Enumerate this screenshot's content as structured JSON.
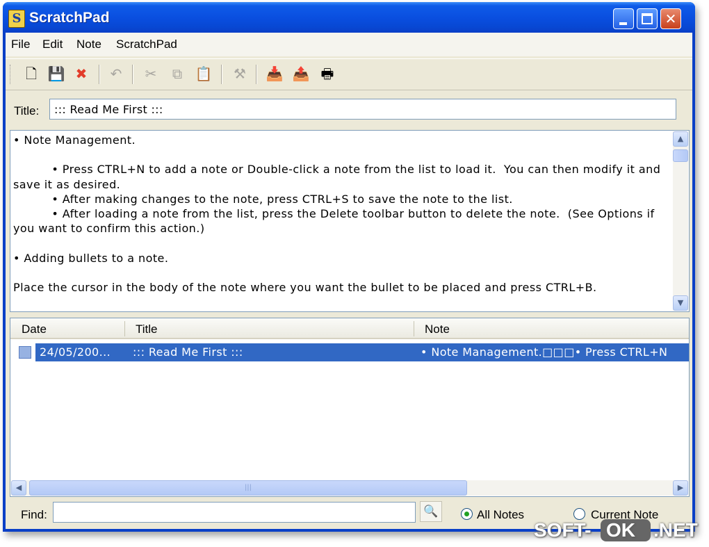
{
  "window": {
    "title": "ScratchPad",
    "icon_letter": "S",
    "minimize_icon": "minimize-icon",
    "maximize_icon": "maximize-icon",
    "close_icon": "close-icon",
    "close_glyph": "✕"
  },
  "menu": {
    "items": [
      {
        "label": "File"
      },
      {
        "label": "Edit"
      },
      {
        "label": "Note"
      },
      {
        "label": "ScratchPad"
      }
    ]
  },
  "toolbar": {
    "buttons": [
      {
        "icon": "new-note-icon",
        "glyph": "🗋",
        "enabled": true
      },
      {
        "icon": "save-icon",
        "glyph": "💾",
        "enabled": false
      },
      {
        "icon": "delete-icon",
        "glyph": "✖",
        "enabled": true,
        "color": "#e23c2a"
      },
      {
        "icon": "undo-icon",
        "glyph": "↶",
        "enabled": false
      },
      {
        "icon": "cut-icon",
        "glyph": "✂",
        "enabled": false
      },
      {
        "icon": "copy-icon",
        "glyph": "⧉",
        "enabled": false
      },
      {
        "icon": "paste-icon",
        "glyph": "📋",
        "enabled": false
      },
      {
        "icon": "options-icon",
        "glyph": "⚒",
        "enabled": false
      },
      {
        "icon": "import-icon",
        "glyph": "📥",
        "enabled": true
      },
      {
        "icon": "export-icon",
        "glyph": "📤",
        "enabled": true
      },
      {
        "icon": "print-icon",
        "glyph": "🖶",
        "enabled": true
      }
    ]
  },
  "title_field": {
    "label": "Title:",
    "value": "::: Read Me First :::"
  },
  "editor": {
    "body": "• Note Management.\n\n          • Press CTRL+N to add a note or Double-click a note from the list to load it.  You can then modify it and save it as desired.\n          • After making changes to the note, press CTRL+S to save the note to the list.\n          • After loading a note from the list, press the Delete toolbar button to delete the note.  (See Options if you want to confirm this action.)\n\n• Adding bullets to a note.\n\nPlace the cursor in the body of the note where you want the bullet to be placed and press CTRL+B.",
    "scroll_up_icon": "scroll-up-icon",
    "scroll_down_icon": "scroll-down-icon"
  },
  "notes_list": {
    "columns": [
      "Date",
      "Title",
      "Note"
    ],
    "rows": [
      {
        "date": "24/05/200...",
        "title": "::: Read Me First :::",
        "note": "• Note Management.□□□• Press CTRL+N",
        "selected": true
      }
    ],
    "scroll_left_icon": "scroll-left-icon",
    "scroll_right_icon": "scroll-right-icon",
    "thumb_grip": "|||"
  },
  "find": {
    "label": "Find:",
    "value": "",
    "button_icon": "find-icon",
    "scope_options": [
      {
        "label": "All Notes",
        "selected": true
      },
      {
        "label": "Current Note",
        "selected": false
      }
    ]
  },
  "watermark": {
    "part1": "SOFT-",
    "part2": "OK",
    "part3": ".NET"
  },
  "colors": {
    "titlebar": "#0a4fe0",
    "selection": "#3168c4",
    "face": "#ece9d8"
  }
}
